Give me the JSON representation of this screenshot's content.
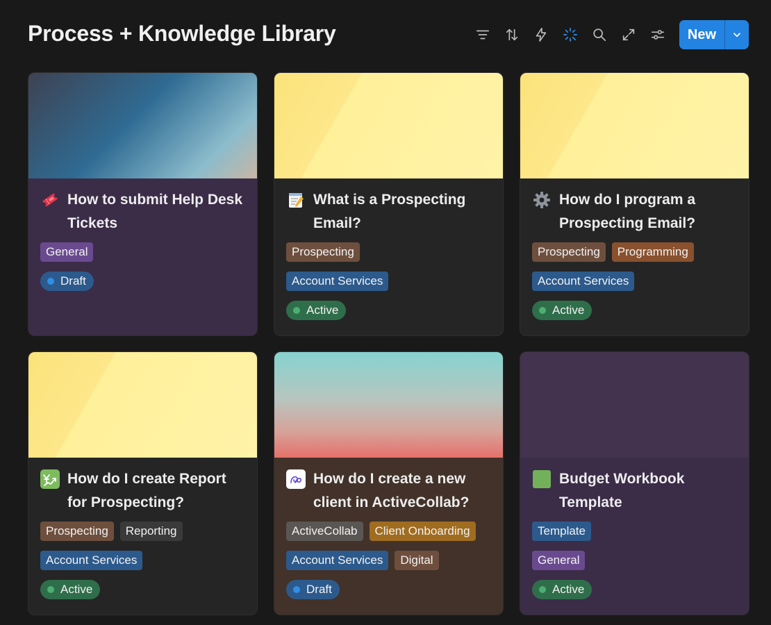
{
  "page": {
    "title": "Process + Knowledge Library"
  },
  "toolbar": {
    "new_label": "New"
  },
  "cards": [
    {
      "title": "How to submit Help Desk Tickets",
      "icon": "ticket-icon",
      "tag_rows": [
        [
          "General"
        ]
      ],
      "status": "Draft"
    },
    {
      "title": "What is a Prospecting Email?",
      "icon": "memo-icon",
      "tag_rows": [
        [
          "Prospecting"
        ],
        [
          "Account Services"
        ]
      ],
      "status": "Active"
    },
    {
      "title": "How do I program a Prospecting Email?",
      "icon": "gear-icon",
      "tag_rows": [
        [
          "Prospecting",
          "Programming"
        ],
        [
          "Account Services"
        ]
      ],
      "status": "Active"
    },
    {
      "title": "How do I create Report for Prospecting?",
      "icon": "chart-yen-icon",
      "tag_rows": [
        [
          "Prospecting",
          "Reporting"
        ],
        [
          "Account Services"
        ]
      ],
      "status": "Active"
    },
    {
      "title": "How do I create a new client in ActiveCollab?",
      "icon": "activecollab-logo-icon",
      "tag_rows": [
        [
          "ActiveCollab",
          "Client Onboarding"
        ],
        [
          "Account Services",
          "Digital"
        ]
      ],
      "status": "Draft"
    },
    {
      "title": "Budget Workbook Template",
      "icon": "green-square-icon",
      "tag_rows": [
        [
          "Template"
        ],
        [
          "General"
        ]
      ],
      "status": "Active"
    }
  ]
}
